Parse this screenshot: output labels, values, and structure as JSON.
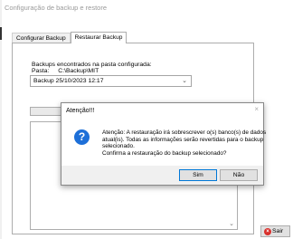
{
  "window": {
    "title": "Configuração de backup e restore"
  },
  "tabs": [
    {
      "label": "Configurar Backup",
      "active": false
    },
    {
      "label": "Restaurar Backup",
      "active": true
    }
  ],
  "restore": {
    "found_label": "Backups encontrados na pasta configurada:",
    "path_label": "Pasta:",
    "path_value": "C:\\Backup\\MIT",
    "selected_backup": "Backup 25/10/2023  12:17"
  },
  "exit_button": {
    "label": "Sair"
  },
  "dialog": {
    "title": "Atenção!!!",
    "message_lines": [
      "Atenção: A restauração irá sobrescrever o(s) banco(s) de dados",
      "atual(is). Todas as informações serão revertidas para o backup",
      "selecionado.",
      "Confirma a restauração do backup selecionado?"
    ],
    "yes_label": "Sim",
    "no_label": "Não"
  },
  "colors": {
    "question_icon": "#1d6fd8",
    "exit_icon": "#d9302c",
    "default_button_border": "#0078d7"
  }
}
